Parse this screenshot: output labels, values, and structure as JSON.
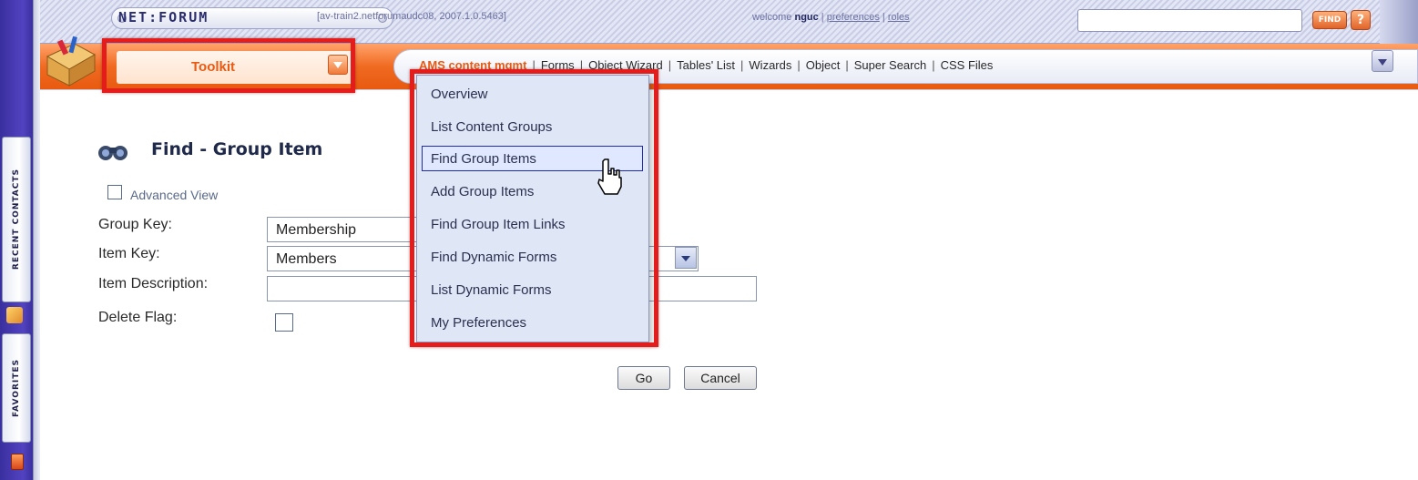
{
  "header": {
    "logo": "NET:FORUM",
    "server_info": "[av-train2.netforumaudc08, 2007.1.0.5463]",
    "welcome_prefix": "welcome ",
    "username": "nguc",
    "sep": " | ",
    "preferences_link": "preferences",
    "roles_link": "roles",
    "search_placeholder": "",
    "find_button": "FIND",
    "help_button": "?"
  },
  "left_dock": {
    "recent_contacts": "RECENT CONTACTS",
    "favorites": "FAVORITES"
  },
  "nav": {
    "module_selected": "Toolkit",
    "links": [
      "AMS content mgmt",
      "Forms",
      "Object Wizard",
      "Tables' List",
      "Wizards",
      "Object",
      "Super Search",
      "CSS Files"
    ]
  },
  "dropdown": {
    "items": [
      "Overview",
      "List Content Groups",
      "Find Group Items",
      "Add Group Items",
      "Find Group Item Links",
      "Find Dynamic Forms",
      "List Dynamic Forms",
      "My Preferences"
    ],
    "highlighted_index": 2
  },
  "form": {
    "title": "Find - Group Item",
    "advanced_view_label": "Advanced View",
    "group_key_label": "Group Key:",
    "group_key_value": "Membership",
    "item_key_label": "Item Key:",
    "item_key_value": "Members",
    "item_description_label": "Item Description:",
    "item_description_value": "",
    "delete_flag_label": "Delete Flag:",
    "go_button": "Go",
    "cancel_button": "Cancel"
  },
  "colors": {
    "accent_orange": "#e95a12",
    "annotation_red": "#e41c1c",
    "highlight_border": "#1f2ea8"
  }
}
